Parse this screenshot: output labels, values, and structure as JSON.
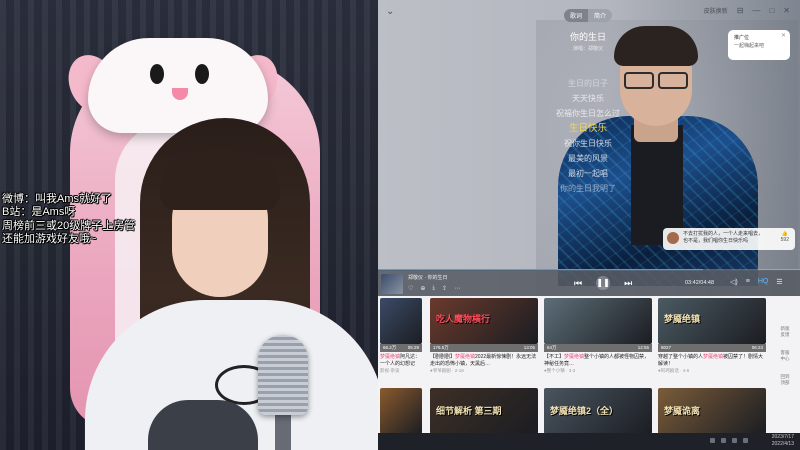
{
  "stream_overlay": {
    "lines": [
      "微博：叫我Ams就好了",
      "B站：是Ams呀",
      "周榜前三或20级牌子上房管",
      "还能加游戏好友哦~"
    ]
  },
  "player": {
    "tabs": [
      "歌词",
      "简介"
    ],
    "skin_label": "皮肤换新",
    "window_controls": [
      "⊟",
      "—",
      "□",
      "✕"
    ],
    "song_title": "你的生日",
    "singer_credit": "演唱：郑敬仪",
    "lyrics": [
      "生日的日子",
      "天天快乐",
      "祝福你生日怎么过",
      "生日快乐",
      "祝你生日快乐",
      "最美的风景",
      "最初一起唱",
      "你的生日我明了"
    ],
    "active_lyric_index": 3,
    "promo": {
      "line1": "推广位",
      "line2": "一起嗨起来吧",
      "close": "✕"
    },
    "comment": {
      "text": "不去打扰我的人，一个人走来唱去，也不是，我们唱你生日快乐吗",
      "likes": "592"
    },
    "now_playing": "郑敬仪 · 你的生日",
    "action_icons": [
      "♡",
      "⊕",
      "⤓",
      "⇪",
      "⋯"
    ],
    "controls": {
      "prev": "⏮",
      "pause": "❚❚",
      "next": "⏭"
    },
    "time": "03:42/04:48",
    "right_icons": [
      "◁)",
      "≡",
      "HQ",
      "☰"
    ],
    "progress": 0.77
  },
  "feed": {
    "cards": [
      {
        "thumb_text": "",
        "views": "66.2万",
        "dur": "05:29",
        "title_pre": "",
        "tag": "",
        "title": "阿凡达：一个人的幻想记",
        "author": "影视·杂谈",
        "color": "#3b4b66"
      },
      {
        "thumb_text": "吃人魔物横行",
        "views": "176.5万",
        "dur": "13:05",
        "title_pre": "【剧剧剧】",
        "tag": "",
        "title": "2022最新惊悚剧！永远无法走出的恐怖小镇，天黑后…",
        "author": "●爷爷剧剧 · 2-18",
        "color": "#6a3a2c"
      },
      {
        "thumb_text": "",
        "views": "64万",
        "dur": "12:55",
        "title_pre": "【不工】",
        "tag": "",
        "title": "整个小镇的人都被怪物囚禁，神秘任务竟…",
        "author": "●整个小镇 · 3-3",
        "color": "#5d6e78"
      },
      {
        "thumb_text": "梦魇绝镇",
        "views": "8027",
        "dur": "06:23",
        "title_pre": "穿越了整个小镇的人",
        "tag": "",
        "title": "被囚禁了！剧情大解读！",
        "author": "●阿珂剧话 · 4-6",
        "color": "#4b5a62"
      },
      {
        "thumb_text": "",
        "views": "",
        "dur": "",
        "title_pre": "",
        "tag": "",
        "title": "",
        "author": "",
        "color": "#8a5a2e"
      },
      {
        "thumb_text": "细节解析 第三期",
        "views": "",
        "dur": "",
        "title_pre": "",
        "tag": "",
        "title": "",
        "author": "",
        "color": "#3d2f26"
      },
      {
        "thumb_text": "梦魇绝镇2（全）",
        "views": "",
        "dur": "",
        "title_pre": "",
        "tag": "",
        "title": "",
        "author": "",
        "color": "#4a5560"
      },
      {
        "thumb_text": "梦魇诡离",
        "views": "",
        "dur": "",
        "title_pre": "",
        "tag": "",
        "title": "",
        "author": "",
        "color": "#7a5c3a"
      }
    ],
    "tag_label": "梦魇绝镇",
    "side_items": [
      "新版\n反馈",
      "客服\n中心",
      "回到\n顶部"
    ]
  },
  "taskbar": {
    "time": "2023/7/17",
    "date": "2022/4/13"
  },
  "colors": {
    "active_lyric": "#f7d64c",
    "progress": "#3ea2ff",
    "tag": "#e8577e"
  }
}
